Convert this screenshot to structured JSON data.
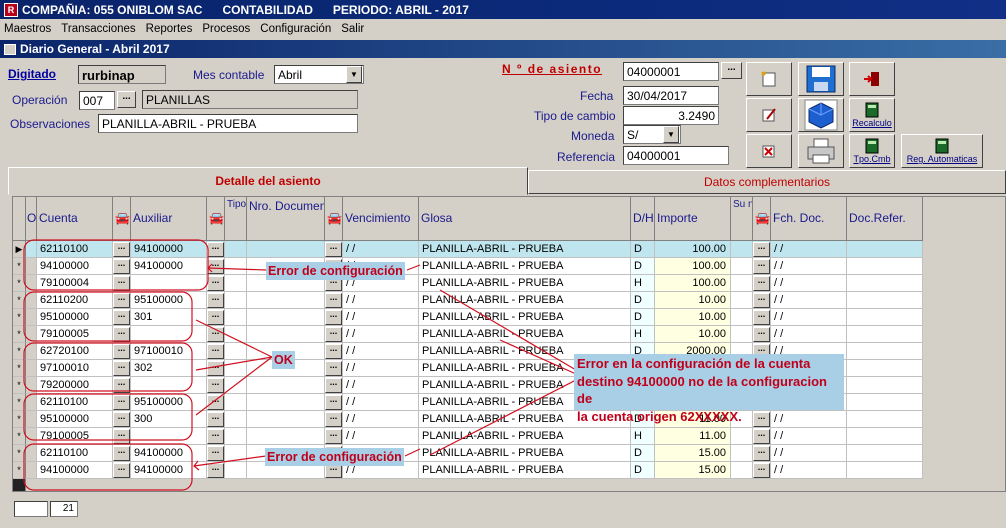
{
  "title_bar": {
    "company": "COMPAÑIA: 055 ONIBLOM SAC",
    "module": "CONTABILIDAD",
    "period": "PERIODO: ABRIL - 2017"
  },
  "menu": [
    "Maestros",
    "Transacciones",
    "Reportes",
    "Procesos",
    "Configuración",
    "Salir"
  ],
  "window_title": "Diario General  - Abril 2017",
  "form": {
    "digitado_label": "Digitado",
    "digitado_value": "rurbinap",
    "mes_label": "Mes contable",
    "mes_value": "Abril",
    "operacion_label": "Operación",
    "operacion_code": "007",
    "operacion_name": "PLANILLAS",
    "observaciones_label": "Observaciones",
    "observaciones_value": "PLANILLA-ABRIL - PRUEBA",
    "asiento_label": "N º de asiento",
    "asiento_value": "04000001",
    "fecha_label": "Fecha",
    "fecha_value": "30/04/2017",
    "tipo_cambio_label": "Tipo de cambio",
    "tipo_cambio_value": "3.2490",
    "moneda_label": "Moneda",
    "moneda_value": "S/",
    "referencia_label": "Referencia",
    "referencia_value": "04000001"
  },
  "toolbar": {
    "recalculo": "Recalculo",
    "tpo_cmb": "Tpo.Cmb",
    "reg_auto": "Reg. Automaticas"
  },
  "tabs": {
    "detalle": "Detalle del asiento",
    "datos": "Datos complementarios"
  },
  "headers": {
    "o": "O",
    "cuenta": "Cuenta",
    "auxiliar": "Auxiliar",
    "tipo_doc": "Tipo Doc",
    "nro_doc": "Nro. Documento",
    "vencimiento": "Vencimiento",
    "glosa": "Glosa",
    "dh": "D/H",
    "importe": "Importe",
    "sunat": "Su nat",
    "fch_doc": "Fch. Doc.",
    "doc_ref": "Doc.Refer."
  },
  "rows": [
    {
      "cuenta": "62110100",
      "auxiliar": "94100000",
      "venc": "/ /",
      "glosa": "PLANILLA-ABRIL - PRUEBA",
      "dh": "D",
      "importe": "100.00",
      "fch": "/ /"
    },
    {
      "cuenta": "94100000",
      "auxiliar": "94100000",
      "venc": "/ /",
      "glosa": "PLANILLA-ABRIL - PRUEBA",
      "dh": "D",
      "importe": "100.00",
      "fch": "/ /"
    },
    {
      "cuenta": "79100004",
      "auxiliar": "",
      "venc": "/ /",
      "glosa": "PLANILLA-ABRIL - PRUEBA",
      "dh": "H",
      "importe": "100.00",
      "fch": "/ /"
    },
    {
      "cuenta": "62110200",
      "auxiliar": "95100000",
      "venc": "/ /",
      "glosa": "PLANILLA-ABRIL - PRUEBA",
      "dh": "D",
      "importe": "10.00",
      "fch": "/ /"
    },
    {
      "cuenta": "95100000",
      "auxiliar": "301",
      "venc": "/ /",
      "glosa": "PLANILLA-ABRIL - PRUEBA",
      "dh": "D",
      "importe": "10.00",
      "fch": "/ /"
    },
    {
      "cuenta": "79100005",
      "auxiliar": "",
      "venc": "/ /",
      "glosa": "PLANILLA-ABRIL - PRUEBA",
      "dh": "H",
      "importe": "10.00",
      "fch": "/ /"
    },
    {
      "cuenta": "62720100",
      "auxiliar": "97100010",
      "venc": "/ /",
      "glosa": "PLANILLA-ABRIL - PRUEBA",
      "dh": "D",
      "importe": "2000.00",
      "fch": "/ /"
    },
    {
      "cuenta": "97100010",
      "auxiliar": "302",
      "venc": "/ /",
      "glosa": "PLANILLA-ABRIL - PRUEBA",
      "dh": "D",
      "importe": "",
      "fch": "/ /"
    },
    {
      "cuenta": "79200000",
      "auxiliar": "",
      "venc": "/ /",
      "glosa": "PLANILLA-ABRIL - PRUEBA",
      "dh": "H",
      "importe": "",
      "fch": "/ /"
    },
    {
      "cuenta": "62110100",
      "auxiliar": "95100000",
      "venc": "/ /",
      "glosa": "PLANILLA-ABRIL - PRUEBA",
      "dh": "D",
      "importe": "11.00",
      "fch": "/ /"
    },
    {
      "cuenta": "95100000",
      "auxiliar": "300",
      "venc": "/ /",
      "glosa": "PLANILLA-ABRIL - PRUEBA",
      "dh": "D",
      "importe": "11.00",
      "fch": "/ /"
    },
    {
      "cuenta": "79100005",
      "auxiliar": "",
      "venc": "/ /",
      "glosa": "PLANILLA-ABRIL - PRUEBA",
      "dh": "H",
      "importe": "11.00",
      "fch": "/ /"
    },
    {
      "cuenta": "62110100",
      "auxiliar": "94100000",
      "venc": "/ /",
      "glosa": "PLANILLA-ABRIL - PRUEBA",
      "dh": "D",
      "importe": "15.00",
      "fch": "/ /"
    },
    {
      "cuenta": "94100000",
      "auxiliar": "94100000",
      "venc": "/ /",
      "glosa": "PLANILLA-ABRIL - PRUEBA",
      "dh": "D",
      "importe": "15.00",
      "fch": "/ /"
    }
  ],
  "annotations": {
    "error1": "Error de configuración",
    "ok": "OK",
    "error2": "Error de configuración",
    "big_note_1": "Error en la configuración de la cuenta",
    "big_note_2": "destino 94100000 no de la configuracion de",
    "big_note_3": "la cuenta origen 62XXXXX."
  },
  "status": {
    "count": "21"
  }
}
